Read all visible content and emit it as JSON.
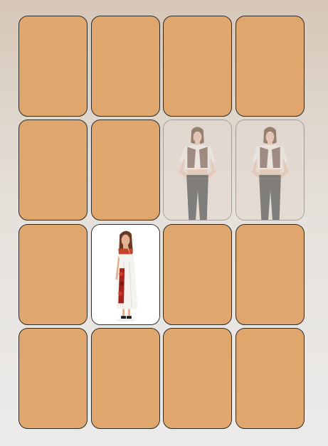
{
  "board": {
    "rows": 4,
    "columns": 4,
    "card_back_color": "#dfa76e",
    "cards": [
      {
        "state": "face-down"
      },
      {
        "state": "face-down"
      },
      {
        "state": "face-down"
      },
      {
        "state": "face-down"
      },
      {
        "state": "face-down"
      },
      {
        "state": "face-down"
      },
      {
        "state": "matched",
        "image": "model-white-crop-top-black-pants"
      },
      {
        "state": "matched",
        "image": "model-white-crop-top-black-pants"
      },
      {
        "state": "face-down"
      },
      {
        "state": "face-up",
        "image": "model-white-dress-red-accent"
      },
      {
        "state": "face-down"
      },
      {
        "state": "face-down"
      },
      {
        "state": "face-down"
      },
      {
        "state": "face-down"
      },
      {
        "state": "face-down"
      },
      {
        "state": "face-down"
      }
    ]
  }
}
